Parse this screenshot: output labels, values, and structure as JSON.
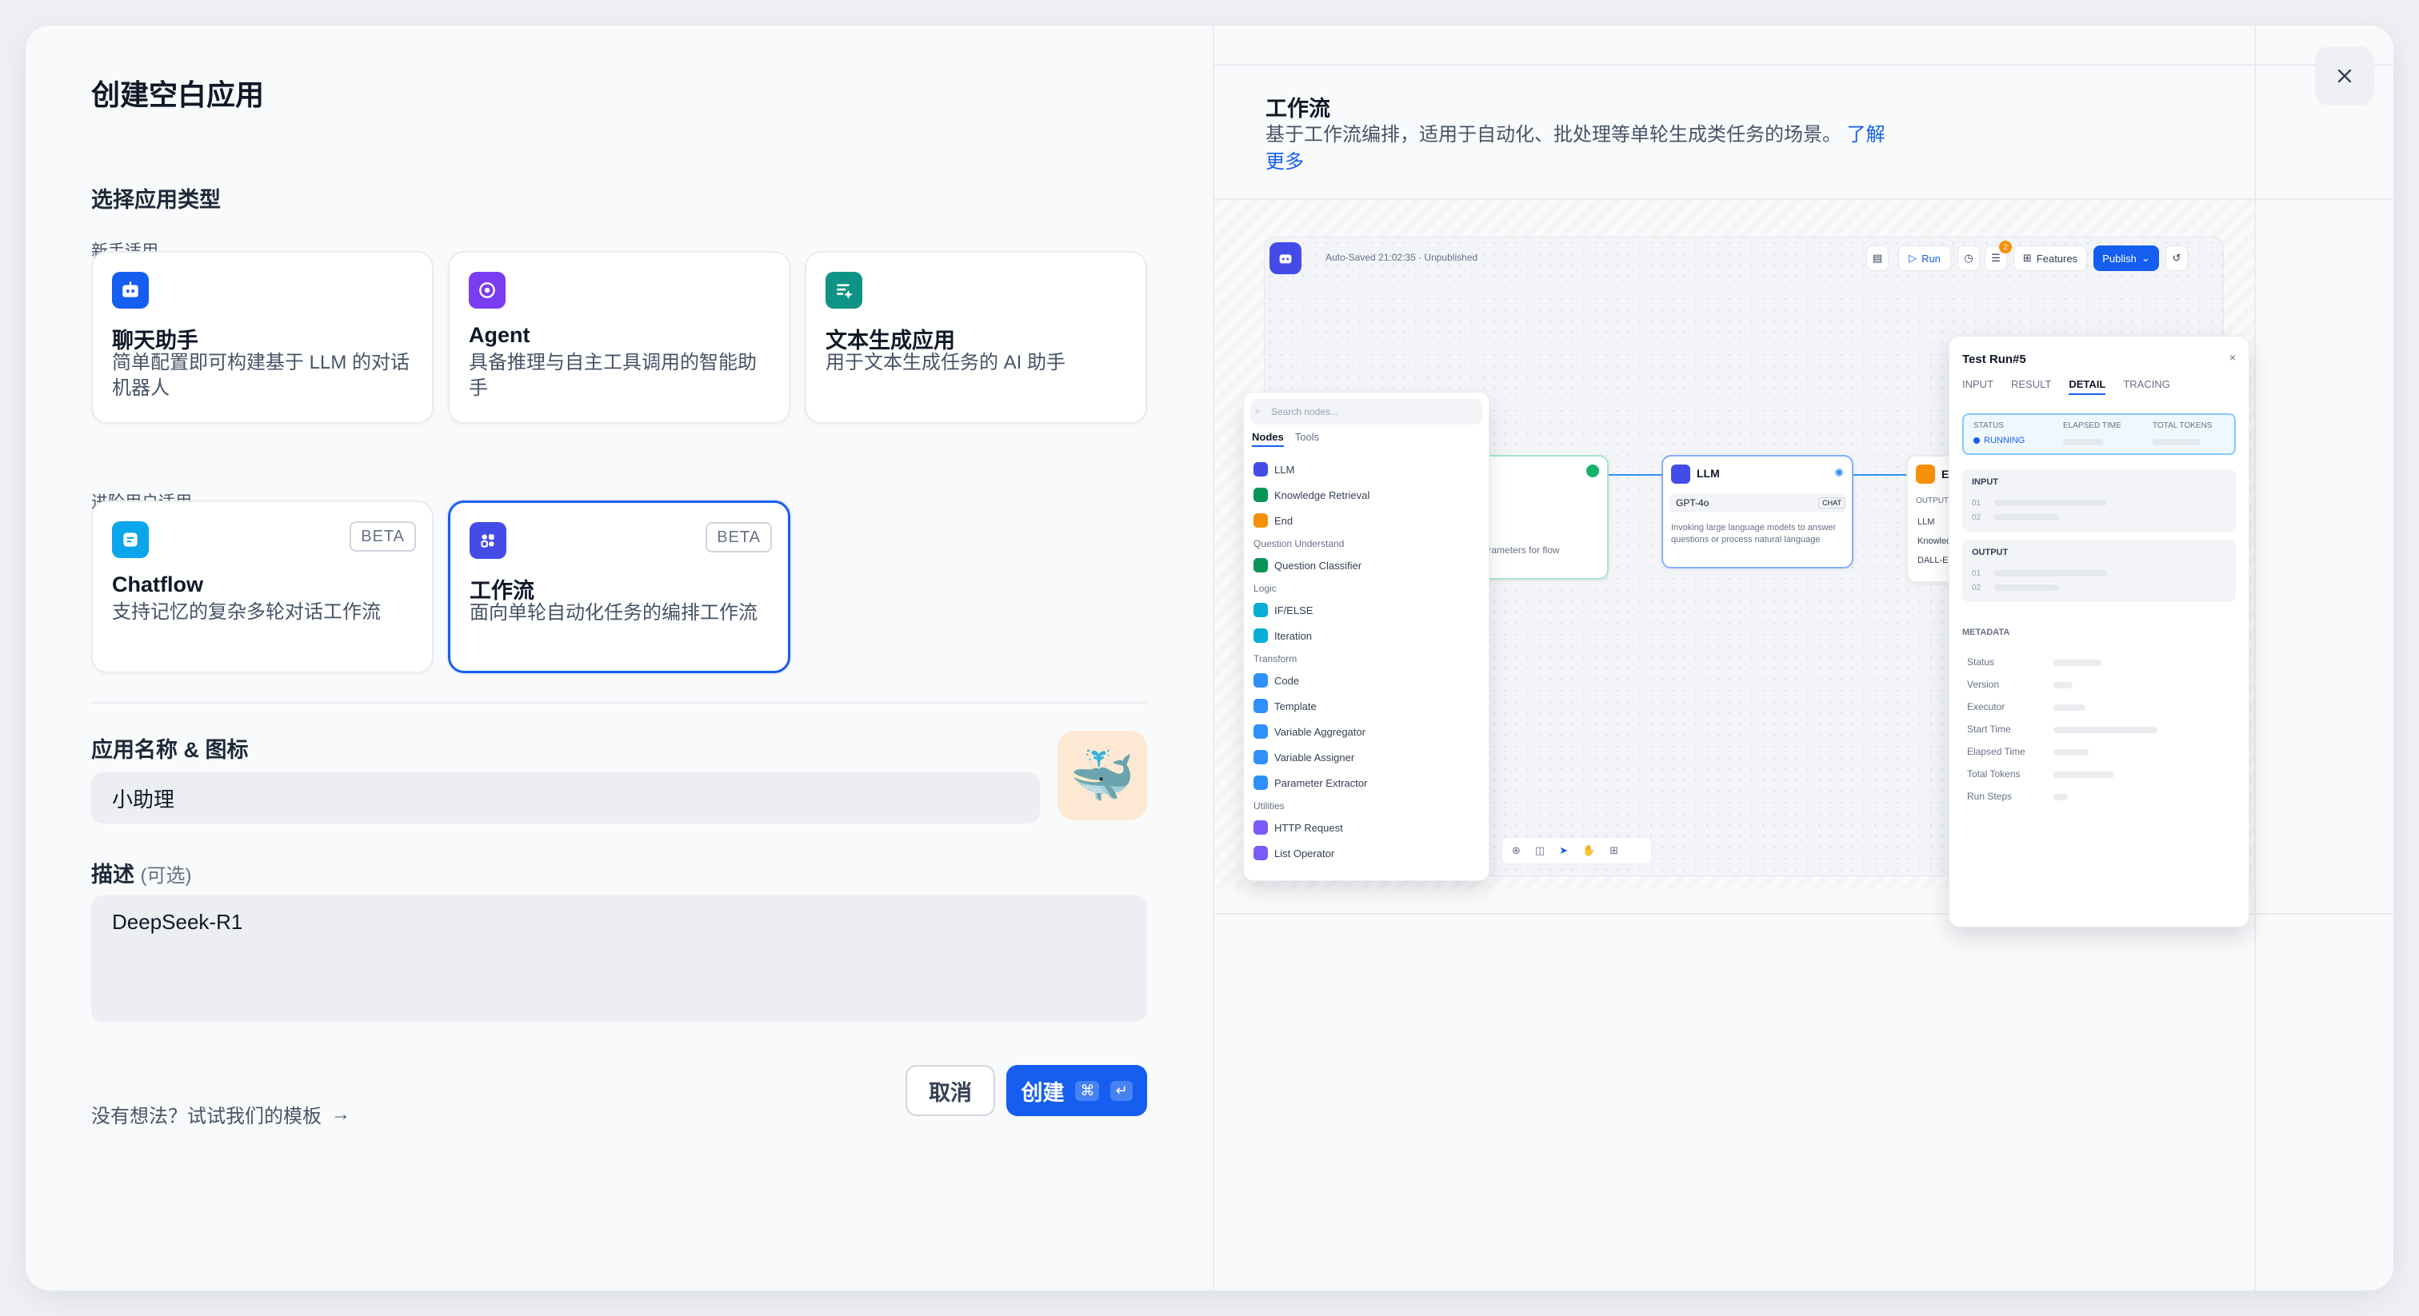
{
  "dialog": {
    "title": "创建空白应用",
    "choose_type": "选择应用类型",
    "beginner_label": "新手适用",
    "advanced_label": "进阶用户适用",
    "beginner_cards": [
      {
        "name": "聊天助手",
        "desc": "简单配置即可构建基于 LLM 的对话机器人",
        "icon": "chat-bot-icon",
        "color": "#155eef"
      },
      {
        "name": "Agent",
        "desc": "具备推理与自主工具调用的智能助手",
        "icon": "agent-icon",
        "color": "#7a3cf0"
      },
      {
        "name": "文本生成应用",
        "desc": "用于文本生成任务的 AI 助手",
        "icon": "text-generation-icon",
        "color": "#0e9384"
      }
    ],
    "advanced_cards": [
      {
        "name": "Chatflow",
        "desc": "支持记忆的复杂多轮对话工作流",
        "badge": "BETA",
        "icon": "chatflow-icon",
        "color": "#0ba5ec"
      },
      {
        "name": "工作流",
        "desc": "面向单轮自动化任务的编排工作流",
        "badge": "BETA",
        "icon": "workflow-icon",
        "color": "#444ce7",
        "selected": true
      }
    ],
    "name_icon_label": "应用名称 & 图标",
    "name_value": "小助理",
    "app_icon": "whale-emoji",
    "app_icon_glyph": "🐳",
    "desc_label": "描述",
    "desc_optional": "(可选)",
    "desc_value": "DeepSeek-R1",
    "template_link": "没有想法？试试我们的模板",
    "template_arrow": "→",
    "cancel_label": "取消",
    "create_label": "创建",
    "create_kbd_cmd": "⌘",
    "create_kbd_enter": "↵",
    "close_icon": "close-icon"
  },
  "preview": {
    "title": "工作流",
    "desc": "基于工作流编排，适用于自动化、批处理等单轮生成类任务的场景。",
    "learn_more": "了解更多",
    "autosave": "Auto-Saved 21:02:35 · Unpublished",
    "run_label": "Run",
    "features_label": "Features",
    "publish_label": "Publish",
    "badge_count": "2",
    "search_placeholder": "Search nodes...",
    "tabs": [
      "Nodes",
      "Tools"
    ],
    "node_items": [
      {
        "type": "item",
        "label": "LLM",
        "color": "#444ce7"
      },
      {
        "type": "item",
        "label": "Knowledge Retrieval",
        "color": "#079455"
      },
      {
        "type": "item",
        "label": "End",
        "color": "#f79009"
      },
      {
        "type": "group",
        "label": "Question Understand"
      },
      {
        "type": "item",
        "label": "Question Classifier",
        "color": "#079455"
      },
      {
        "type": "group",
        "label": "Logic"
      },
      {
        "type": "item",
        "label": "IF/ELSE",
        "color": "#06aed4"
      },
      {
        "type": "item",
        "label": "Iteration",
        "color": "#06aed4"
      },
      {
        "type": "group",
        "label": "Transform"
      },
      {
        "type": "item",
        "label": "Code",
        "color": "#2e90fa"
      },
      {
        "type": "item",
        "label": "Template",
        "color": "#2e90fa"
      },
      {
        "type": "item",
        "label": "Variable Aggregator",
        "color": "#2e90fa"
      },
      {
        "type": "item",
        "label": "Variable Assigner",
        "color": "#2e90fa"
      },
      {
        "type": "item",
        "label": "Parameter Extractor",
        "color": "#2e90fa"
      },
      {
        "type": "group",
        "label": "Utilities"
      },
      {
        "type": "item",
        "label": "HTTP Request",
        "color": "#7a5af8"
      },
      {
        "type": "item",
        "label": "List Operator",
        "color": "#7a5af8"
      }
    ],
    "llm_node": {
      "title": "LLM",
      "model": "GPT-4o",
      "mode": "CHAT",
      "desc": "Invoking large language models to answer questions or process natural language"
    },
    "start_node_text": "parameters for flow",
    "end_node": {
      "title": "END",
      "output_label": "OUTPUT VARI...",
      "outputs": [
        "LLM",
        "Knowled...",
        "DALL-E"
      ]
    },
    "test_run": {
      "title": "Test Run#5",
      "tabs": [
        "INPUT",
        "RESULT",
        "DETAIL",
        "TRACING"
      ],
      "active_tab": "DETAIL",
      "status_label": "STATUS",
      "status_value": "RUNNING",
      "elapsed_label": "ELAPSED TIME",
      "tokens_label": "TOTAL TOKENS",
      "input_label": "INPUT",
      "output_label": "OUTPUT",
      "line_nums": [
        "01",
        "02"
      ],
      "metadata_label": "METADATA",
      "metadata_rows": [
        "Status",
        "Version",
        "Executor",
        "Start Time",
        "Elapsed Time",
        "Total Tokens",
        "Run Steps"
      ]
    }
  }
}
